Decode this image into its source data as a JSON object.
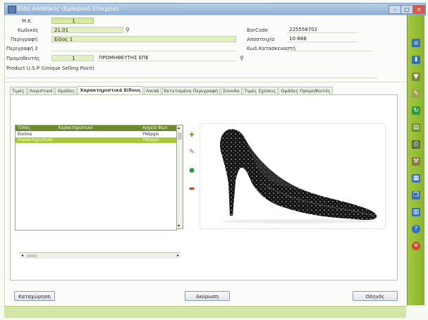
{
  "window": {
    "title": "Είδη Αποθήκης (Εμπορικά Στοιχεία)"
  },
  "fields": {
    "mk_label": "Μ.Κ.",
    "mk_value": "1",
    "code_label": "Κωδικός",
    "code_value": "21.01",
    "desc_label": "Περιγραφή",
    "desc_value": "Είδος 1",
    "desc2_label": "Περιγραφή 2",
    "desc2_value": "",
    "supplier_label": "Προμηθευτής",
    "supplier_code": "1",
    "supplier_name": "ΠΡΟΜΗΘΕΥΤΗΣ ΕΠΕ",
    "usp_label": "Product U.S.P (Unique Selling Point)",
    "usp_value": "",
    "barcode_label": "BarCode",
    "barcode_value": "225558702",
    "manuf_label": "Αποστοιχία",
    "manuf_value": "10-868",
    "manufcode_label": "Κωδ.Κατασκευαστή",
    "manufcode_value": ""
  },
  "tabs": [
    "Τιμές",
    "Λογιστικά",
    "Ομάδες",
    "Χαρακτηριστικά Είδους",
    "Λοιπά",
    "Εκτεταμένη Περιγραφή",
    "Σύνολα",
    "Τιμές Σχέσεις",
    "Ομάδες Προμηθευτές"
  ],
  "active_tab": 3,
  "list": {
    "headers": [
      "Τύπος",
      "Χαρακτηριστικό",
      "Αρχείο Φωτ."
    ],
    "rows": [
      {
        "type": "Εικόνα",
        "attr": "",
        "file": "Υπάρχει"
      },
      {
        "type": "Χαρακτηριστικό",
        "attr": "",
        "file": "Υπάρχει"
      }
    ],
    "selected": 1
  },
  "buttons": {
    "register": "Καταχώρηση",
    "cancel": "Ακύρωση",
    "guide": "Οδηγός"
  },
  "colors": {
    "accent_green": "#a9c93a",
    "header_green": "#6f8a2c",
    "toolbar_green": "#8fbc2f"
  },
  "icons": {
    "side_actions": [
      "add-icon",
      "edit-icon",
      "refresh-icon",
      "delete-icon"
    ],
    "toolbar": [
      "home-icon",
      "download-icon",
      "filter-icon",
      "edit-icon",
      "refresh-icon",
      "document-icon",
      "print-icon",
      "tools-icon",
      "page-icon",
      "copy-icon",
      "report-icon",
      "help-icon",
      "close-icon"
    ]
  }
}
